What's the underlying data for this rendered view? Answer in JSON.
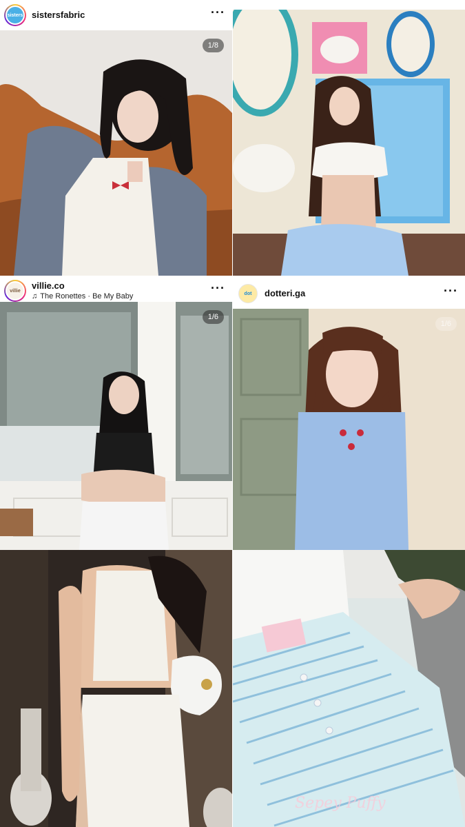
{
  "posts": [
    {
      "username": "sistersfabric",
      "avatar_text": "sisters",
      "counter": "1/8"
    },
    {
      "username": "",
      "counter": ""
    },
    {
      "username": "villie.co",
      "avatar_text": "villie",
      "music": "The Ronettes · Be My Baby",
      "counter": "1/6"
    },
    {
      "username": "dotteri.ga",
      "avatar_text": "dot",
      "counter": "1/6"
    },
    {
      "username": "",
      "counter": ""
    },
    {
      "username": "",
      "watermark": "Sepey Puffy"
    }
  ],
  "icons": {
    "more": "more-horizontal-icon",
    "music": "music-note-icon"
  },
  "colors": {
    "accent_ring": "#ee2a7b",
    "background": "#ffffff"
  }
}
